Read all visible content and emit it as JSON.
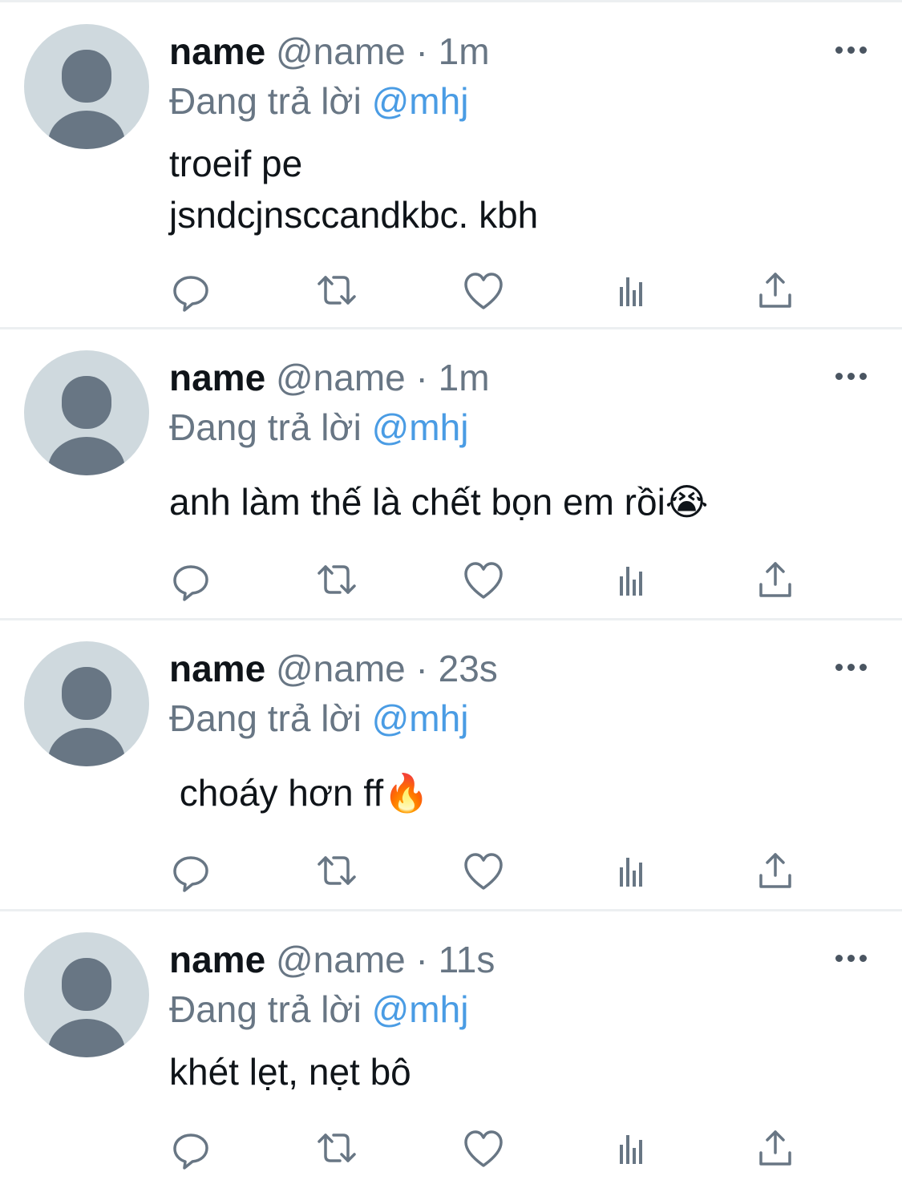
{
  "tweets": [
    {
      "name": "name",
      "handle": "@name",
      "sep": "·",
      "time": "1m",
      "reply_prefix": "Đang trả lời",
      "reply_to": "@mhj",
      "content": "troeif pe\njsndcjnsccandkbc. kbh"
    },
    {
      "name": "name",
      "handle": "@name",
      "sep": "·",
      "time": "1m",
      "reply_prefix": "Đang trả lời",
      "reply_to": "@mhj",
      "content": "anh làm thế là chết bọn em rồi😭"
    },
    {
      "name": "name",
      "handle": "@name",
      "sep": "·",
      "time": "23s",
      "reply_prefix": "Đang trả lời",
      "reply_to": "@mhj",
      "content": " choáy hơn ff🔥"
    },
    {
      "name": "name",
      "handle": "@name",
      "sep": "·",
      "time": "11s",
      "reply_prefix": "Đang trả lời",
      "reply_to": "@mhj",
      "content": "khét lẹt, nẹt bô"
    }
  ],
  "actions": [
    "reply-icon",
    "retweet-icon",
    "like-icon",
    "analytics-icon",
    "share-icon"
  ],
  "colors": {
    "text": "#0f1419",
    "secondary": "#687684",
    "mention": "#4a9ce4",
    "icon": "#687684",
    "divider": "#eceff1"
  }
}
